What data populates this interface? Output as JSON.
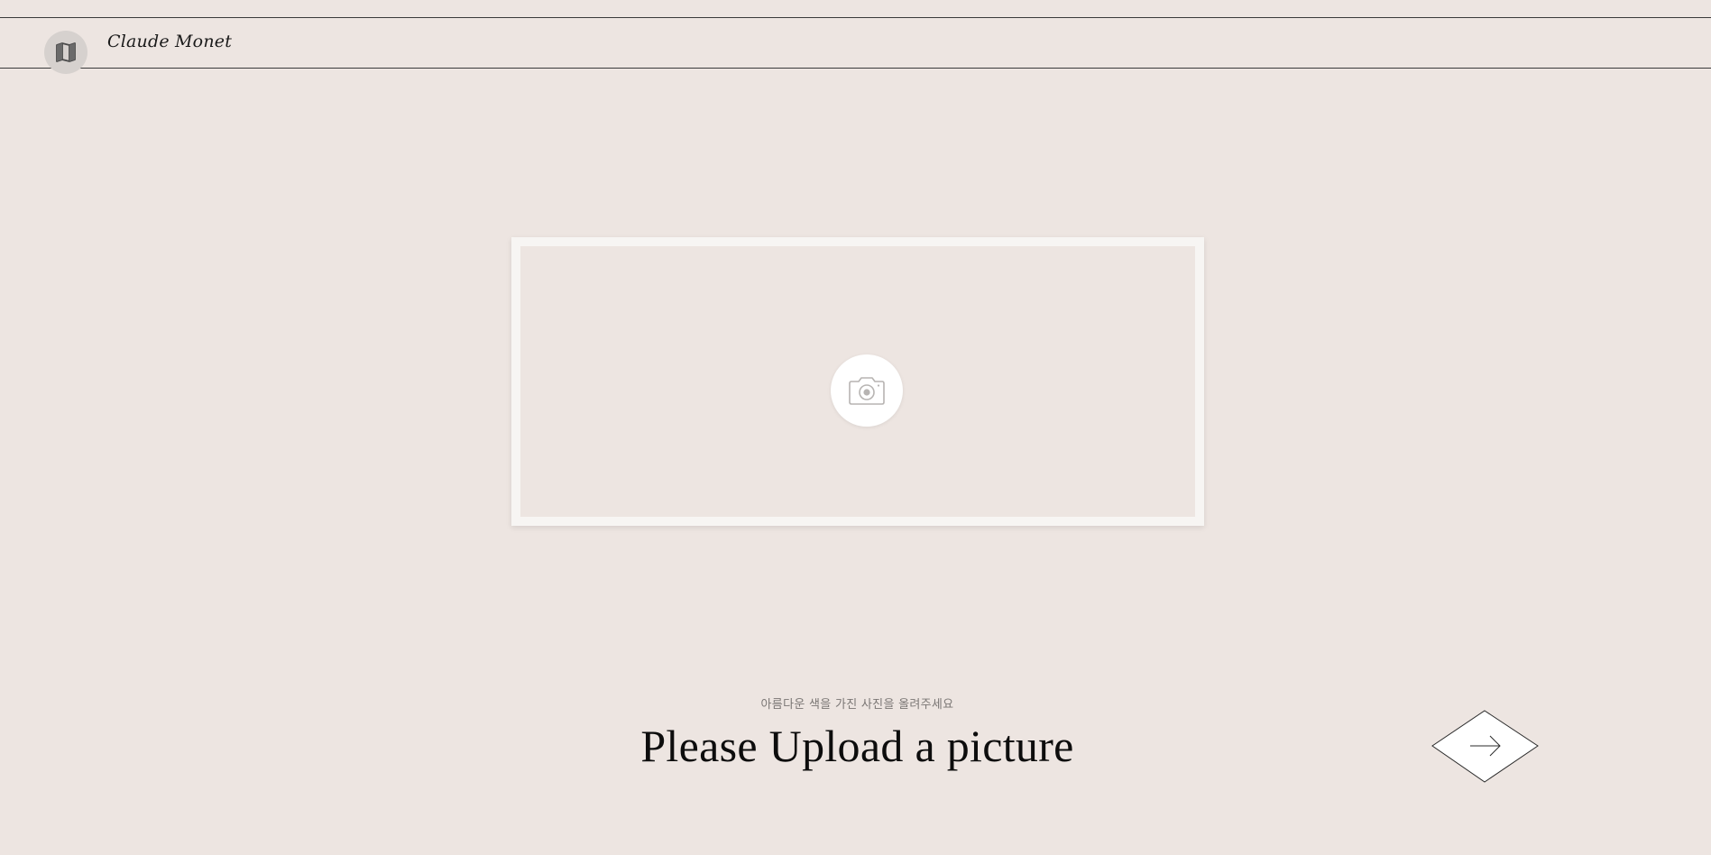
{
  "header": {
    "artist_name": "Claude Monet",
    "map_icon": "map-icon"
  },
  "upload": {
    "camera_icon": "camera-icon"
  },
  "prompt": {
    "subtitle": "아름다운 색을 가진 사진을 올려주세요",
    "headline": "Please Upload a picture"
  },
  "navigation": {
    "next_icon": "arrow-right-icon"
  },
  "colors": {
    "background": "#ede5e1",
    "frame": "#f7f5f3",
    "text": "#0d0d0d",
    "subtitle": "#7a7674"
  }
}
